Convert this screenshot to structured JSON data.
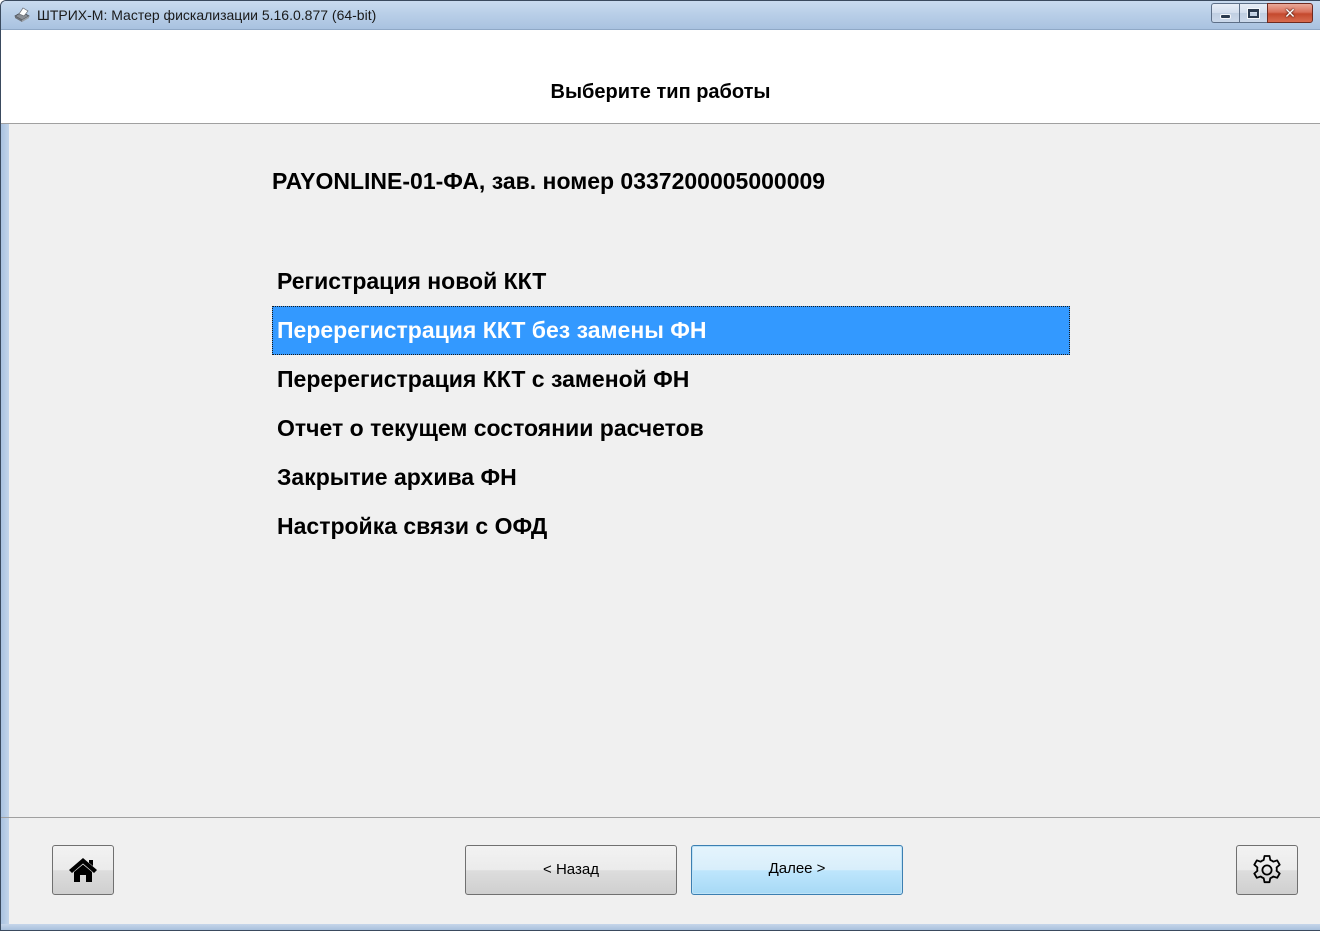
{
  "window": {
    "title": "ШТРИХ-М: Мастер фискализации 5.16.0.877 (64-bit)",
    "close_glyph": "✕"
  },
  "header": {
    "title": "Выберите тип работы"
  },
  "device": {
    "info": "PAYONLINE-01-ФА, зав. номер 0337200005000009"
  },
  "menu": {
    "items": [
      {
        "label": "Регистрация новой ККТ",
        "selected": false
      },
      {
        "label": "Перерегистрация ККТ без замены ФН",
        "selected": true
      },
      {
        "label": "Перерегистрация ККТ с заменой ФН",
        "selected": false
      },
      {
        "label": "Отчет о текущем состоянии расчетов",
        "selected": false
      },
      {
        "label": "Закрытие архива ФН",
        "selected": false
      },
      {
        "label": "Настройка связи с ОФД",
        "selected": false
      }
    ]
  },
  "footer": {
    "back_label": "< Назад",
    "next_label": "Далее >",
    "home_icon": "home-icon",
    "settings_icon": "gear-icon"
  },
  "colors": {
    "selection": "#3399ff",
    "window_background": "#f0f0f0"
  }
}
